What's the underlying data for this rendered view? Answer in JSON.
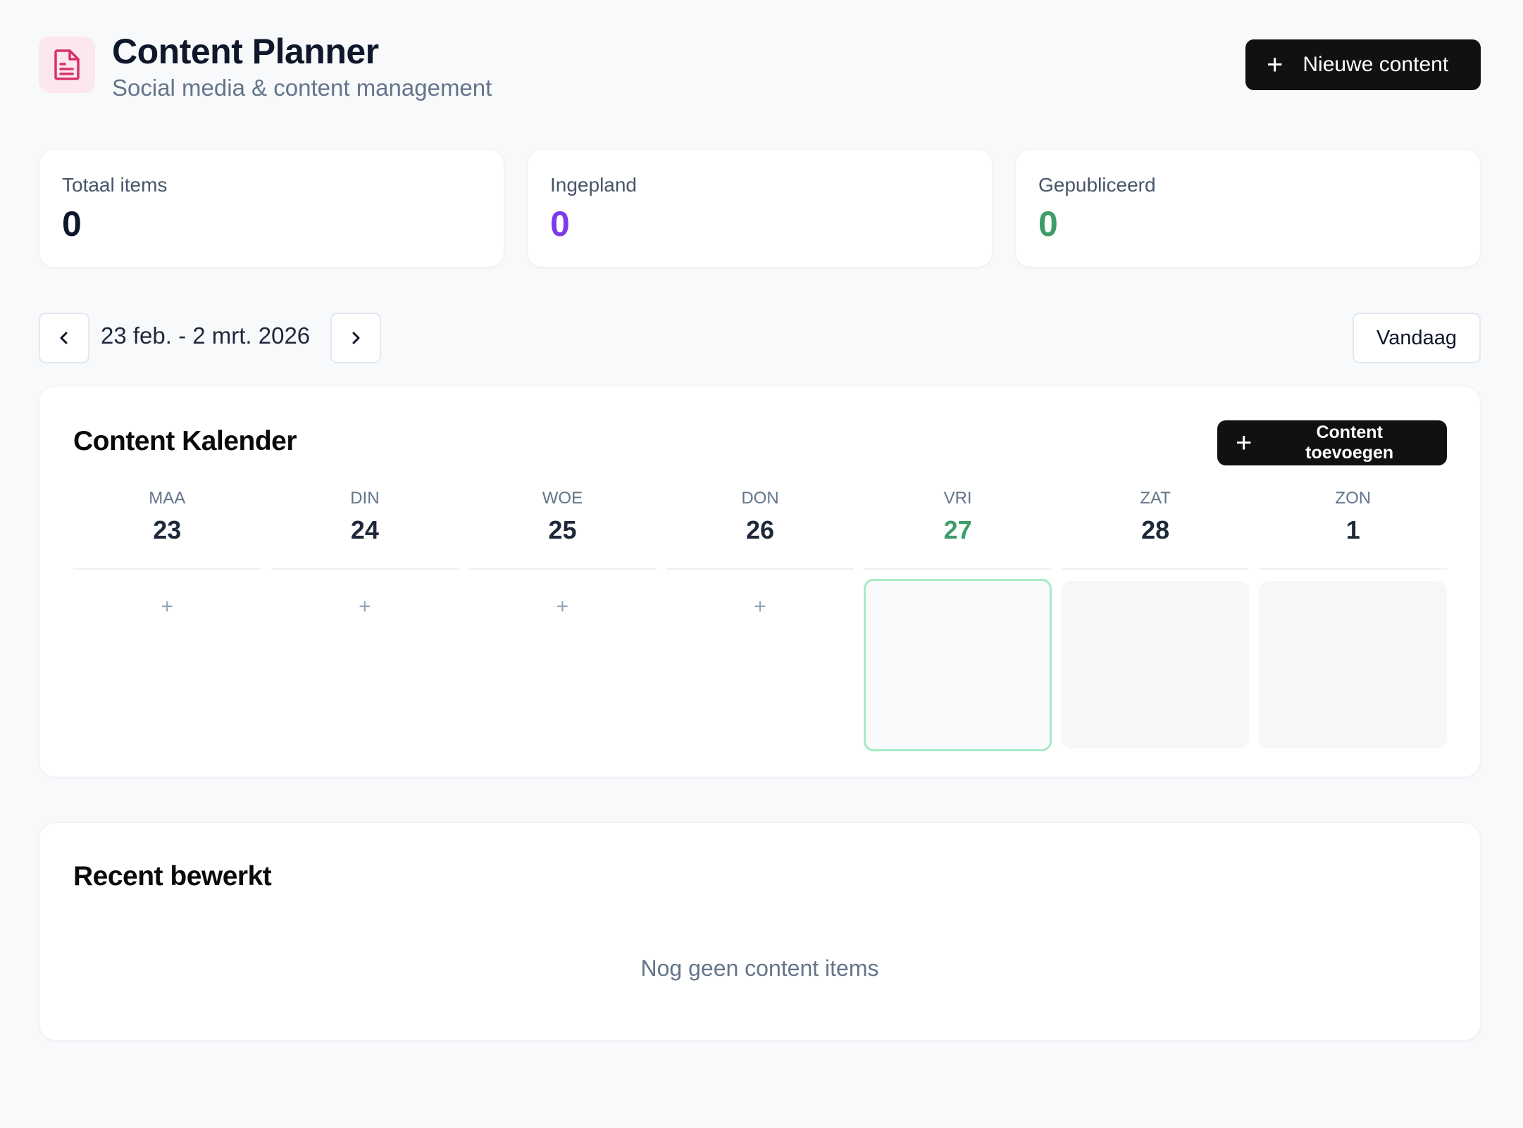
{
  "header": {
    "title": "Content Planner",
    "subtitle": "Social media & content management",
    "new_content_label": "Nieuwe content"
  },
  "stats": [
    {
      "label": "Totaal items",
      "value": "0",
      "color": "#0f172a"
    },
    {
      "label": "Ingepland",
      "value": "0",
      "color": "#7c3aed"
    },
    {
      "label": "Gepubliceerd",
      "value": "0",
      "color": "#3f9d6a"
    }
  ],
  "week_nav": {
    "range": "23 feb. - 2 mrt. 2026",
    "today_label": "Vandaag"
  },
  "calendar": {
    "title": "Content Kalender",
    "add_label": "Content toevoegen",
    "days": [
      {
        "name": "MAA",
        "number": "23",
        "add": "+"
      },
      {
        "name": "DIN",
        "number": "24",
        "add": "+"
      },
      {
        "name": "WOE",
        "number": "25",
        "add": "+"
      },
      {
        "name": "DON",
        "number": "26",
        "add": "+"
      },
      {
        "name": "VRI",
        "number": "27",
        "add": ""
      },
      {
        "name": "ZAT",
        "number": "28",
        "add": ""
      },
      {
        "name": "ZON",
        "number": "1",
        "add": ""
      }
    ]
  },
  "recent": {
    "title": "Recent bewerkt",
    "empty_text": "Nog geen content items"
  },
  "icons": {
    "logo": "document-icon",
    "plus": "plus-icon",
    "prev": "chevron-left-icon",
    "next": "chevron-right-icon"
  },
  "colors": {
    "accent_pink": "#d6336c",
    "today_green": "#3f9d6a",
    "scheduled_purple": "#7c3aed"
  }
}
